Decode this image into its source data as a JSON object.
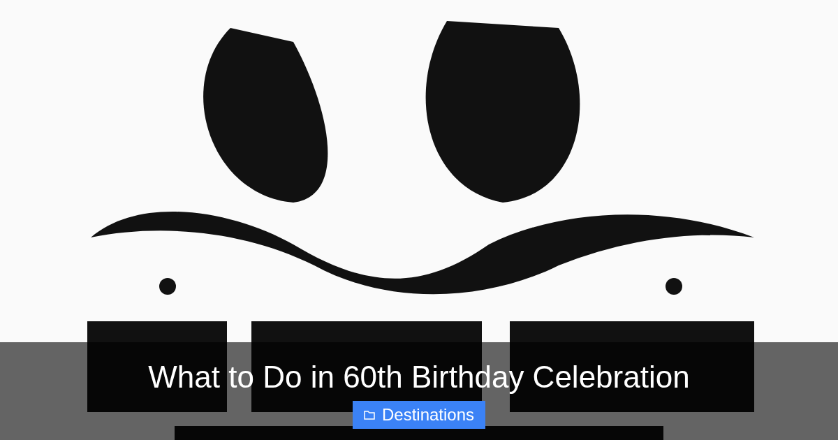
{
  "title": "What to Do in 60th Birthday Celebration",
  "category": {
    "label": "Destinations"
  }
}
